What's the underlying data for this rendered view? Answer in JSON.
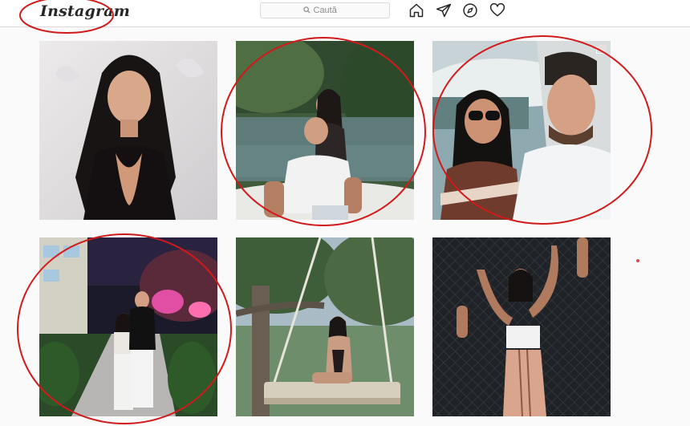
{
  "header": {
    "logo_text": "Instagram",
    "search_placeholder": "Caută"
  },
  "nav_icons": [
    "home-icon",
    "direct-send-icon",
    "explore-compass-icon",
    "activity-heart-icon"
  ],
  "posts": [
    {
      "id": "post-1",
      "subject": "woman-portrait",
      "circled": false
    },
    {
      "id": "post-2",
      "subject": "couple-on-boat",
      "circled": true
    },
    {
      "id": "post-3",
      "subject": "couple-selfie",
      "circled": true,
      "multiple_photos": true
    },
    {
      "id": "post-4",
      "subject": "couple-night-garden",
      "circled": true
    },
    {
      "id": "post-5",
      "subject": "woman-on-swing",
      "circled": false
    },
    {
      "id": "post-6",
      "subject": "woman-against-fence",
      "circled": false
    }
  ],
  "colors": {
    "annotation_red": "#d11a1a",
    "border": "#dbdbdb",
    "background": "#fafafa"
  }
}
